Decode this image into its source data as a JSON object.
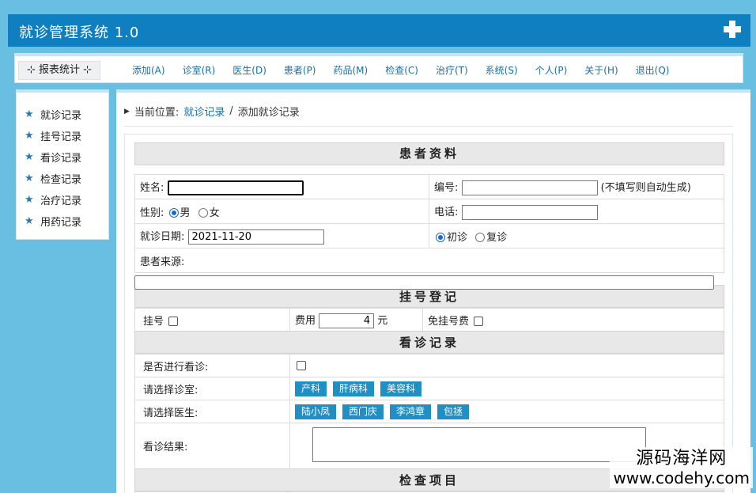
{
  "app": {
    "title": "就诊管理系统 1.0"
  },
  "menubar": {
    "stats_label": "⊹ 报表统计 ⊹",
    "items": [
      "添加(A)",
      "诊室(R)",
      "医生(D)",
      "患者(P)",
      "药品(M)",
      "检查(C)",
      "治疗(T)",
      "系统(S)",
      "个人(P)",
      "关于(H)",
      "退出(Q)"
    ]
  },
  "sidebar": {
    "items": [
      "就诊记录",
      "挂号记录",
      "看诊记录",
      "检查记录",
      "治疗记录",
      "用药记录"
    ]
  },
  "breadcrumb": {
    "prefix": "当前位置:",
    "link": "就诊记录",
    "sep": "/",
    "current": "添加就诊记录"
  },
  "patient": {
    "section_title": "患者资料",
    "name_label": "姓名:",
    "name_value": "",
    "id_label": "编号:",
    "id_value": "",
    "id_hint": "(不填写则自动生成)",
    "gender_label": "性别:",
    "gender_options": [
      "男",
      "女"
    ],
    "phone_label": "电话:",
    "phone_value": "",
    "date_label": "就诊日期:",
    "date_value": "2021-11-20",
    "visit_options": [
      "初诊",
      "复诊"
    ],
    "source_label": "患者来源:"
  },
  "registration": {
    "section_title": "挂号登记",
    "reg_label": "挂号",
    "fee_label": "费用",
    "fee_value": "4",
    "fee_unit": "元",
    "waive_label": "免挂号费"
  },
  "consult": {
    "section_title": "看诊记录",
    "do_consult_label": "是否进行看诊:",
    "room_label": "请选择诊室:",
    "rooms": [
      "产科",
      "肝病科",
      "美容科"
    ],
    "doctor_label": "请选择医生:",
    "doctors": [
      "陆小凤",
      "西门庆",
      "李鸿章",
      "包拯"
    ],
    "result_label": "看诊结果:"
  },
  "exam": {
    "section_title": "检查项目"
  },
  "watermark": {
    "cn": "源码海洋网",
    "en": "www.codehy.com"
  }
}
